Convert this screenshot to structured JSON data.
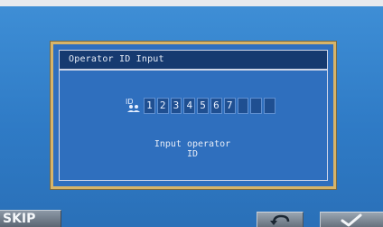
{
  "dialog": {
    "title": "Operator ID Input",
    "operator_id": {
      "digits": [
        "1",
        "2",
        "3",
        "4",
        "5",
        "6",
        "7",
        "",
        "",
        ""
      ]
    },
    "prompt": "Input operator ID"
  },
  "bottom_bar": {
    "skip_label": "SKIP",
    "back_icon": "return-arrow-icon",
    "confirm_icon": "check-icon"
  },
  "colors": {
    "screen_bg": "#2f7bc6",
    "dialog_border": "#d7b468",
    "titlebar": "#163a70"
  }
}
